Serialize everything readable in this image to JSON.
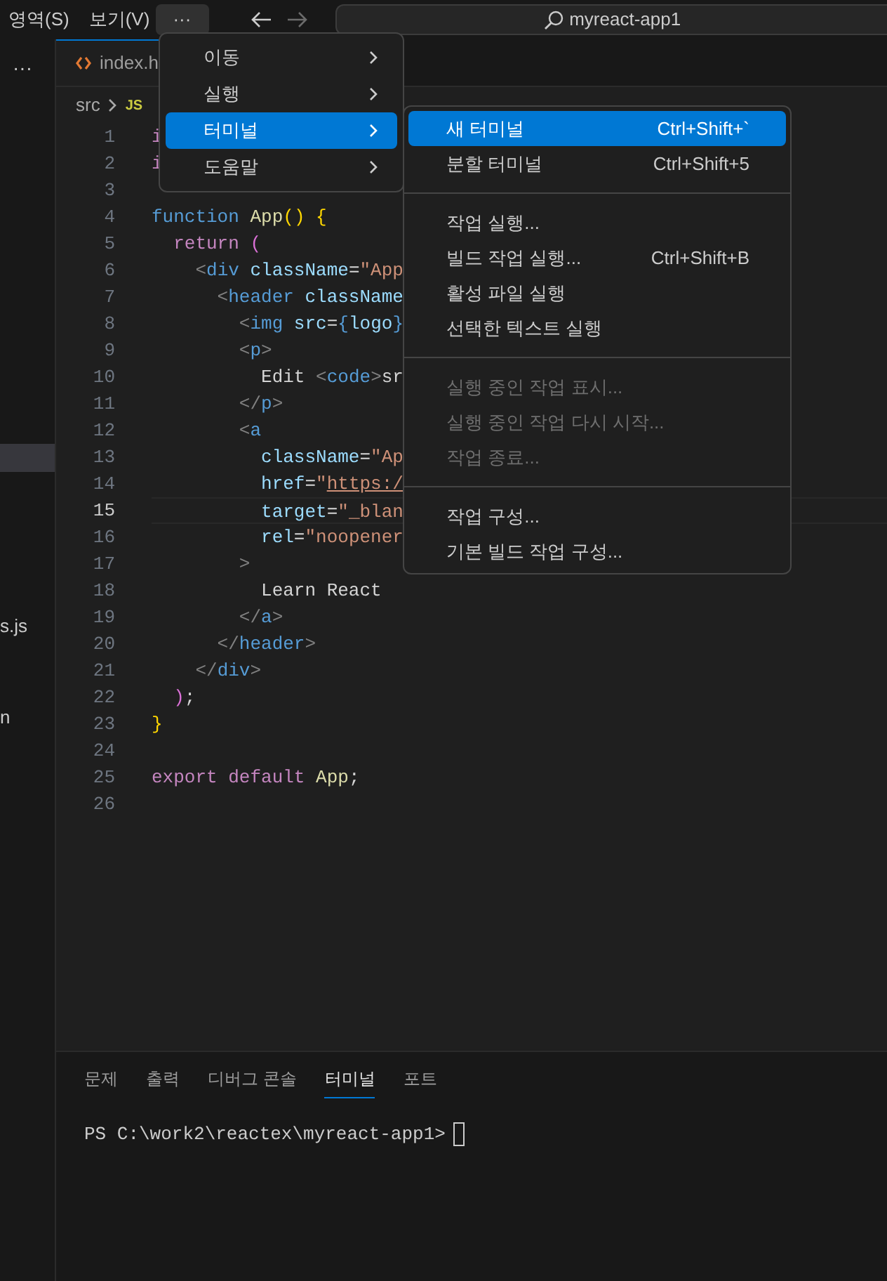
{
  "title_bar": {
    "menus": [
      {
        "label": "영역(S)"
      },
      {
        "label": "보기(V)"
      }
    ],
    "more_button": {
      "label": "···",
      "selected": true
    },
    "back_disabled": false,
    "forward_disabled": true,
    "search": {
      "value": "myreact-app1"
    }
  },
  "sidebar": {
    "more": "···",
    "items": [
      {
        "selected": true
      },
      {
        "label": "s.js",
        "selected": false
      },
      {
        "label": "n",
        "selected": false
      }
    ]
  },
  "editor": {
    "tab": {
      "label": "index.h"
    },
    "breadcrumb": {
      "folder": "src",
      "file_badge": "JS"
    },
    "lines": [
      {
        "number": "1",
        "current": false,
        "tokens": [
          {
            "kind": "control",
            "text": "i"
          }
        ]
      },
      {
        "number": "2",
        "current": false,
        "tokens": [
          {
            "kind": "control",
            "text": "i"
          }
        ]
      },
      {
        "number": "3",
        "current": false
      },
      {
        "number": "4",
        "current": false,
        "tokens": [
          {
            "kind": "keyword",
            "text": "function"
          },
          {
            "kind": "func",
            "text": " App"
          },
          {
            "kind": "bracket",
            "text": "() {"
          }
        ]
      },
      {
        "number": "5",
        "current": false,
        "tokens": [
          {
            "kind": "control",
            "text": "  return"
          },
          {
            "kind": "bracket2",
            "text": " ("
          }
        ]
      },
      {
        "number": "6",
        "current": false,
        "tokens": [
          {
            "kind": "punct",
            "text": "    <"
          },
          {
            "kind": "tag",
            "text": "div"
          },
          {
            "kind": "attr",
            "text": " className"
          },
          {
            "kind": "plain",
            "text": "="
          },
          {
            "kind": "string",
            "text": "\"App"
          }
        ]
      },
      {
        "number": "7",
        "current": false,
        "tokens": [
          {
            "kind": "punct",
            "text": "      <"
          },
          {
            "kind": "tag",
            "text": "header"
          },
          {
            "kind": "attr",
            "text": " className"
          }
        ]
      },
      {
        "number": "8",
        "current": false,
        "tokens": [
          {
            "kind": "punct",
            "text": "        <"
          },
          {
            "kind": "tag",
            "text": "img"
          },
          {
            "kind": "attr",
            "text": " src"
          },
          {
            "kind": "plain",
            "text": "="
          },
          {
            "kind": "tag",
            "text": "{"
          },
          {
            "kind": "attr",
            "text": "logo"
          },
          {
            "kind": "tag",
            "text": "}"
          }
        ]
      },
      {
        "number": "9",
        "current": false,
        "tokens": [
          {
            "kind": "punct",
            "text": "        <"
          },
          {
            "kind": "tag",
            "text": "p"
          },
          {
            "kind": "punct",
            "text": ">"
          }
        ]
      },
      {
        "number": "10",
        "current": false,
        "tokens": [
          {
            "kind": "plain",
            "text": "          Edit "
          },
          {
            "kind": "punct",
            "text": "<"
          },
          {
            "kind": "tag",
            "text": "code"
          },
          {
            "kind": "punct",
            "text": ">"
          },
          {
            "kind": "plain",
            "text": "sr"
          }
        ]
      },
      {
        "number": "11",
        "current": false,
        "tokens": [
          {
            "kind": "punct",
            "text": "        </"
          },
          {
            "kind": "tag",
            "text": "p"
          },
          {
            "kind": "punct",
            "text": ">"
          }
        ]
      },
      {
        "number": "12",
        "current": false,
        "tokens": [
          {
            "kind": "punct",
            "text": "        <"
          },
          {
            "kind": "tag",
            "text": "a"
          }
        ]
      },
      {
        "number": "13",
        "current": false,
        "tokens": [
          {
            "kind": "attr",
            "text": "          className"
          },
          {
            "kind": "plain",
            "text": "="
          },
          {
            "kind": "string",
            "text": "\"Ap"
          }
        ]
      },
      {
        "number": "14",
        "current": false,
        "tokens": [
          {
            "kind": "attr",
            "text": "          href"
          },
          {
            "kind": "plain",
            "text": "="
          },
          {
            "kind": "string",
            "text": "\""
          },
          {
            "kind": "link",
            "text": "https:/"
          }
        ]
      },
      {
        "number": "15",
        "current": true,
        "tokens": [
          {
            "kind": "attr",
            "text": "          target"
          },
          {
            "kind": "plain",
            "text": "="
          },
          {
            "kind": "string",
            "text": "\"_blan"
          }
        ]
      },
      {
        "number": "16",
        "current": false,
        "tokens": [
          {
            "kind": "attr",
            "text": "          rel"
          },
          {
            "kind": "plain",
            "text": "="
          },
          {
            "kind": "string",
            "text": "\"noopener"
          }
        ]
      },
      {
        "number": "17",
        "current": false,
        "tokens": [
          {
            "kind": "punct",
            "text": "        >"
          }
        ]
      },
      {
        "number": "18",
        "current": false,
        "tokens": [
          {
            "kind": "plain",
            "text": "          Learn React"
          }
        ]
      },
      {
        "number": "19",
        "current": false,
        "tokens": [
          {
            "kind": "punct",
            "text": "        </"
          },
          {
            "kind": "tag",
            "text": "a"
          },
          {
            "kind": "punct",
            "text": ">"
          }
        ]
      },
      {
        "number": "20",
        "current": false,
        "tokens": [
          {
            "kind": "punct",
            "text": "      </"
          },
          {
            "kind": "tag",
            "text": "header"
          },
          {
            "kind": "punct",
            "text": ">"
          }
        ]
      },
      {
        "number": "21",
        "current": false,
        "tokens": [
          {
            "kind": "punct",
            "text": "    </"
          },
          {
            "kind": "tag",
            "text": "div"
          },
          {
            "kind": "punct",
            "text": ">"
          }
        ]
      },
      {
        "number": "22",
        "current": false,
        "tokens": [
          {
            "kind": "bracket2",
            "text": "  )"
          },
          {
            "kind": "plain",
            "text": ";"
          }
        ]
      },
      {
        "number": "23",
        "current": false,
        "tokens": [
          {
            "kind": "bracket",
            "text": "}"
          }
        ]
      },
      {
        "number": "24",
        "current": false
      },
      {
        "number": "25",
        "current": false,
        "tokens": [
          {
            "kind": "control",
            "text": "export default"
          },
          {
            "kind": "func",
            "text": " App"
          },
          {
            "kind": "plain",
            "text": ";"
          }
        ]
      },
      {
        "number": "26",
        "current": false
      }
    ]
  },
  "menu": {
    "items": [
      {
        "label": "이동",
        "selected": false
      },
      {
        "label": "실행",
        "selected": false
      },
      {
        "label": "터미널",
        "selected": true
      },
      {
        "label": "도움말",
        "selected": false
      }
    ]
  },
  "submenu": {
    "items": [
      {
        "kind": "item",
        "label": "새 터미널",
        "shortcut": "Ctrl+Shift+`",
        "selected": true,
        "disabled": false
      },
      {
        "kind": "item",
        "label": "분할 터미널",
        "shortcut": "Ctrl+Shift+5",
        "selected": false,
        "disabled": false
      },
      {
        "kind": "separator"
      },
      {
        "kind": "item",
        "label": "작업 실행...",
        "selected": false,
        "disabled": false
      },
      {
        "kind": "item",
        "label": "빌드 작업 실행...",
        "shortcut": "Ctrl+Shift+B",
        "selected": false,
        "disabled": false
      },
      {
        "kind": "item",
        "label": "활성 파일 실행",
        "selected": false,
        "disabled": false
      },
      {
        "kind": "item",
        "label": "선택한 텍스트 실행",
        "selected": false,
        "disabled": false
      },
      {
        "kind": "separator"
      },
      {
        "kind": "item",
        "label": "실행 중인 작업 표시...",
        "selected": false,
        "disabled": true
      },
      {
        "kind": "item",
        "label": "실행 중인 작업 다시 시작...",
        "selected": false,
        "disabled": true
      },
      {
        "kind": "item",
        "label": "작업 종료...",
        "selected": false,
        "disabled": true
      },
      {
        "kind": "separator"
      },
      {
        "kind": "item",
        "label": "작업 구성...",
        "selected": false,
        "disabled": false
      },
      {
        "kind": "item",
        "label": "기본 빌드 작업 구성...",
        "selected": false,
        "disabled": false
      }
    ]
  },
  "panel": {
    "tabs": [
      {
        "label": "문제",
        "selected": false
      },
      {
        "label": "출력",
        "selected": false
      },
      {
        "label": "디버그 콘솔",
        "selected": false
      },
      {
        "label": "터미널",
        "selected": true
      },
      {
        "label": "포트",
        "selected": false
      }
    ],
    "terminal": {
      "prompt": "PS C:\\work2\\reactex\\myreact-app1>"
    }
  }
}
